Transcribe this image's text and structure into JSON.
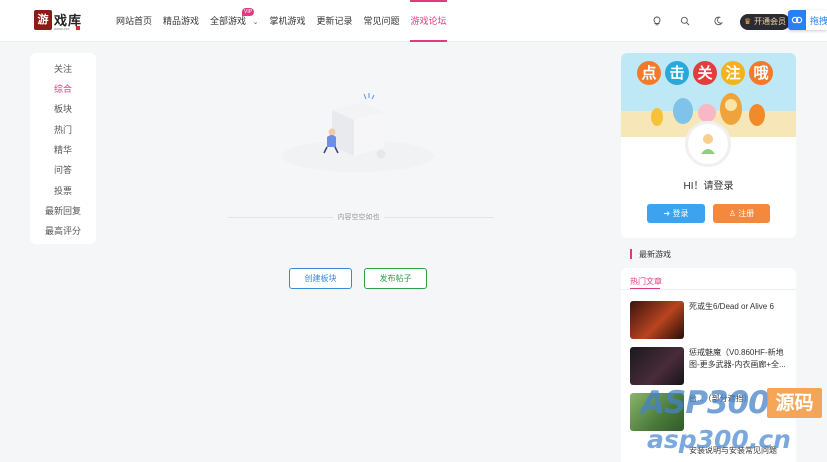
{
  "header": {
    "logo": {
      "text": "游戏库",
      "sub": "www.xxx"
    },
    "nav": [
      {
        "label": "网站首页"
      },
      {
        "label": "精品游戏"
      },
      {
        "label": "全部游戏",
        "badge": "VIP"
      },
      {
        "label": "掌机游戏"
      },
      {
        "label": "更新记录"
      },
      {
        "label": "常见问题"
      },
      {
        "label": "游戏论坛"
      }
    ],
    "open_vip": "开通会员",
    "baidu_btn": "拖拽"
  },
  "sidebar": {
    "items": [
      "关注",
      "综合",
      "板块",
      "热门",
      "精华",
      "问答",
      "投票",
      "最新回复",
      "最高评分"
    ]
  },
  "main": {
    "empty_text": "内容空空如也",
    "create_board": "创建板块",
    "publish_post": "发布帖子"
  },
  "profile": {
    "banner_letters": [
      "点",
      "击",
      "关",
      "注",
      "哦"
    ],
    "greeting": "HI！请登录",
    "login": "登录",
    "register": "注册"
  },
  "latest_games": {
    "title": "最新游戏"
  },
  "hot_articles": {
    "title": "热门文章",
    "items": [
      {
        "title": "死或生6/Dead or Alive 6"
      },
      {
        "title": "惩戒魅魔（V0.860HF-新地图-更多武器-内衣画廊+全..."
      },
      {
        "title": "台...（部分遮挡）"
      },
      {
        "title": "安装说明与安装常见问题"
      }
    ]
  },
  "watermark": {
    "brand": "ASP300",
    "code": "源码",
    "url": "asp300.cn"
  },
  "colors": {
    "accent": "#e13b7f",
    "login": "#3ba3f0",
    "register": "#f4883c",
    "create_board": "#3b8ad8",
    "publish_post": "#2f9e4c"
  }
}
